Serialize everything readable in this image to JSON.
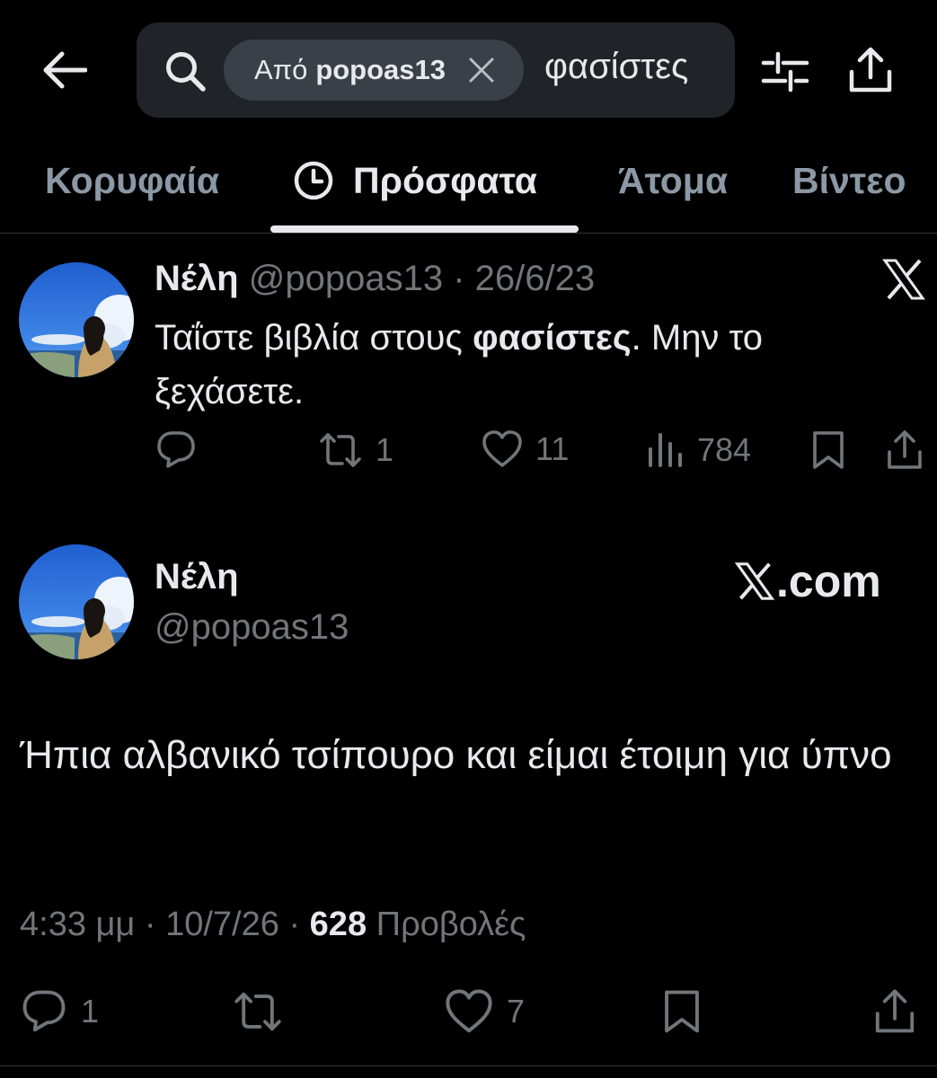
{
  "search": {
    "chip_prefix": "Από",
    "chip_user": "popoas13",
    "query": "φασίστες"
  },
  "tabs": [
    {
      "label": "Κορυφαία",
      "active": false
    },
    {
      "label": "Πρόσφατα",
      "active": true
    },
    {
      "label": "Άτομα",
      "active": false
    },
    {
      "label": "Βίντεο",
      "active": false
    }
  ],
  "tweet1": {
    "name": "Νέλη",
    "handle": "@popoas13",
    "separator": "·",
    "date": "26/6/23",
    "text_before": "Ταΐστε βιβλία στους ",
    "text_bold": "φασίστες",
    "text_after": ". Μην το ξεχάσετε.",
    "reposts": "1",
    "likes": "11",
    "views": "784"
  },
  "tweet2": {
    "name": "Νέλη",
    "handle": "@popoas13",
    "watermark": ".com",
    "text": "Ήπια αλβανικό τσίπουρο και είμαι έτοιμη για ύπνο",
    "time": "4:33 μμ",
    "separator": "·",
    "date": "10/7/26",
    "views_count": "628",
    "views_label": "Προβολές",
    "replies": "1",
    "likes": "7"
  },
  "colors": {
    "background": "#000000",
    "text": "#e7e9ea",
    "muted": "#71767b",
    "search_bg": "#202327",
    "chip_bg": "#3a4048"
  },
  "icons": {
    "back": "arrow-left-icon",
    "search": "search-icon",
    "chip_close": "close-icon",
    "filter": "sliders-icon",
    "share": "share-icon",
    "clock": "clock-icon",
    "reply": "reply-icon",
    "repost": "repost-icon",
    "like": "heart-icon",
    "views": "views-icon",
    "bookmark": "bookmark-icon",
    "x_logo": "x-logo-icon"
  }
}
